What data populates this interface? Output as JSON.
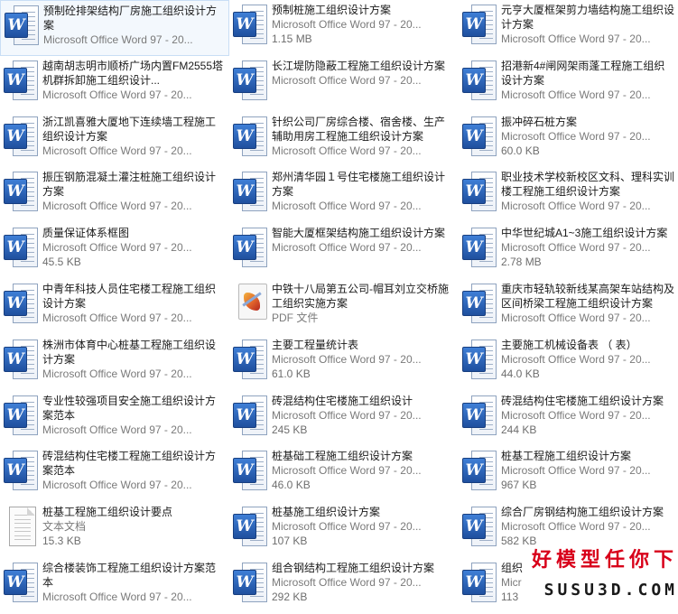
{
  "files": [
    {
      "name": "预制砼排架结构厂房施工组织设计方案",
      "line2": "Microsoft Office Word 97 - 20...",
      "line3": "",
      "icon": "word-doc-icon",
      "selected": true
    },
    {
      "name": "预制桩施工组织设计方案",
      "line2": "Microsoft Office Word 97 - 20...",
      "line3": "1.15 MB",
      "icon": "word-doc-icon"
    },
    {
      "name": "元亨大厦框架剪力墙结构施工组织设计方案",
      "line2": "Microsoft Office Word 97 - 20...",
      "line3": "",
      "icon": "word-doc-icon"
    },
    {
      "name": "越南胡志明市顺桥广场内置FM2555塔机群拆卸施工组织设计...",
      "line2": "Microsoft Office Word 97 - 20...",
      "line3": "",
      "icon": "word-doc-icon"
    },
    {
      "name": "长江堤防隐蔽工程施工组织设计方案",
      "line2": "Microsoft Office Word 97 - 20...",
      "line3": "",
      "icon": "word-doc-icon"
    },
    {
      "name": "招港新4#闸网架雨蓬工程施工组织设计方案",
      "line2": "Microsoft Office Word 97 - 20...",
      "line3": "",
      "icon": "word-doc-icon"
    },
    {
      "name": "浙江凯喜雅大厦地下连续墙工程施工组织设计方案",
      "line2": "Microsoft Office Word 97 - 20...",
      "line3": "",
      "icon": "word-doc-icon"
    },
    {
      "name": "针织公司厂房综合楼、宿舍楼、生产辅助用房工程施工组织设计方案",
      "line2": "Microsoft Office Word 97 - 20...",
      "line3": "",
      "icon": "word-doc-icon"
    },
    {
      "name": "振冲碎石桩方案",
      "line2": "Microsoft Office Word 97 - 20...",
      "line3": "60.0 KB",
      "icon": "word-doc-icon"
    },
    {
      "name": "振压钢筋混凝土灌注桩施工组织设计方案",
      "line2": "Microsoft Office Word 97 - 20...",
      "line3": "",
      "icon": "word-doc-icon"
    },
    {
      "name": "郑州清华园１号住宅楼施工组织设计方案",
      "line2": "Microsoft Office Word 97 - 20...",
      "line3": "",
      "icon": "word-doc-icon"
    },
    {
      "name": "职业技术学校新校区文科、理科实训楼工程施工组织设计方案",
      "line2": "Microsoft Office Word 97 - 20...",
      "line3": "",
      "icon": "word-doc-icon"
    },
    {
      "name": "质量保证体系框图",
      "line2": "Microsoft Office Word 97 - 20...",
      "line3": "45.5 KB",
      "icon": "word-doc-icon"
    },
    {
      "name": "智能大厦框架结构施工组织设计方案",
      "line2": "Microsoft Office Word 97 - 20...",
      "line3": "",
      "icon": "word-doc-icon"
    },
    {
      "name": "中华世纪城A1~3施工组织设计方案",
      "line2": "Microsoft Office Word 97 - 20...",
      "line3": "2.78 MB",
      "icon": "word-doc-icon"
    },
    {
      "name": "中青年科技人员住宅楼工程施工组织设计方案",
      "line2": "Microsoft Office Word 97 - 20...",
      "line3": "",
      "icon": "word-doc-icon"
    },
    {
      "name": "中铁十八局第五公司-帽耳刘立交桥施工组织实施方案",
      "line2": "PDF 文件",
      "line3": "",
      "icon": "pdf-file-icon"
    },
    {
      "name": "重庆市轻轨较新线某高架车站结构及区间桥梁工程施工组织设计方案",
      "line2": "Microsoft Office Word 97 - 20...",
      "line3": "",
      "icon": "word-doc-icon"
    },
    {
      "name": "株洲市体育中心桩基工程施工组织设计方案",
      "line2": "Microsoft Office Word 97 - 20...",
      "line3": "",
      "icon": "word-doc-icon"
    },
    {
      "name": "主要工程量统计表",
      "line2": "Microsoft Office Word 97 - 20...",
      "line3": "61.0 KB",
      "icon": "word-doc-icon"
    },
    {
      "name": "主要施工机械设备表 （ 表）",
      "line2": "Microsoft Office Word 97 - 20...",
      "line3": "44.0 KB",
      "icon": "word-doc-icon"
    },
    {
      "name": "专业性较强项目安全施工组织设计方案范本",
      "line2": "Microsoft Office Word 97 - 20...",
      "line3": "",
      "icon": "word-doc-icon"
    },
    {
      "name": "砖混结构住宅楼施工组织设计",
      "line2": "Microsoft Office Word 97 - 20...",
      "line3": "245 KB",
      "icon": "word-doc-icon"
    },
    {
      "name": "砖混结构住宅楼施工组织设计方案",
      "line2": "Microsoft Office Word 97 - 20...",
      "line3": "244 KB",
      "icon": "word-doc-icon"
    },
    {
      "name": "砖混结构住宅楼工程施工组织设计方案范本",
      "line2": "Microsoft Office Word 97 - 20...",
      "line3": "",
      "icon": "word-doc-icon"
    },
    {
      "name": "桩基础工程施工组织设计方案",
      "line2": "Microsoft Office Word 97 - 20...",
      "line3": "46.0 KB",
      "icon": "word-doc-icon"
    },
    {
      "name": "桩基工程施工组织设计方案",
      "line2": "Microsoft Office Word 97 - 20...",
      "line3": "967 KB",
      "icon": "word-doc-icon"
    },
    {
      "name": "桩基工程施工组织设计要点",
      "line2": "文本文档",
      "line3": "15.3 KB",
      "icon": "text-file-icon"
    },
    {
      "name": "桩基施工组织设计方案",
      "line2": "Microsoft Office Word 97 - 20...",
      "line3": "107 KB",
      "icon": "word-doc-icon"
    },
    {
      "name": "综合厂房钢结构施工组织设计方案",
      "line2": "Microsoft Office Word 97 - 20...",
      "line3": "582 KB",
      "icon": "word-doc-icon"
    },
    {
      "name": "综合楼装饰工程施工组织设计方案范本",
      "line2": "Microsoft Office Word 97 - 20...",
      "line3": "",
      "icon": "word-doc-icon"
    },
    {
      "name": "组合钢结构工程施工组织设计方案",
      "line2": "Microsoft Office Word 97 - 20...",
      "line3": "292 KB",
      "icon": "word-doc-icon"
    },
    {
      "name": "组织",
      "line2": "Micr",
      "line3": "113",
      "icon": "word-doc-icon"
    }
  ],
  "watermark": {
    "top_text": "好模型任你下",
    "bottom_text": "SUSU3D.COM",
    "color": "#d8001a"
  }
}
